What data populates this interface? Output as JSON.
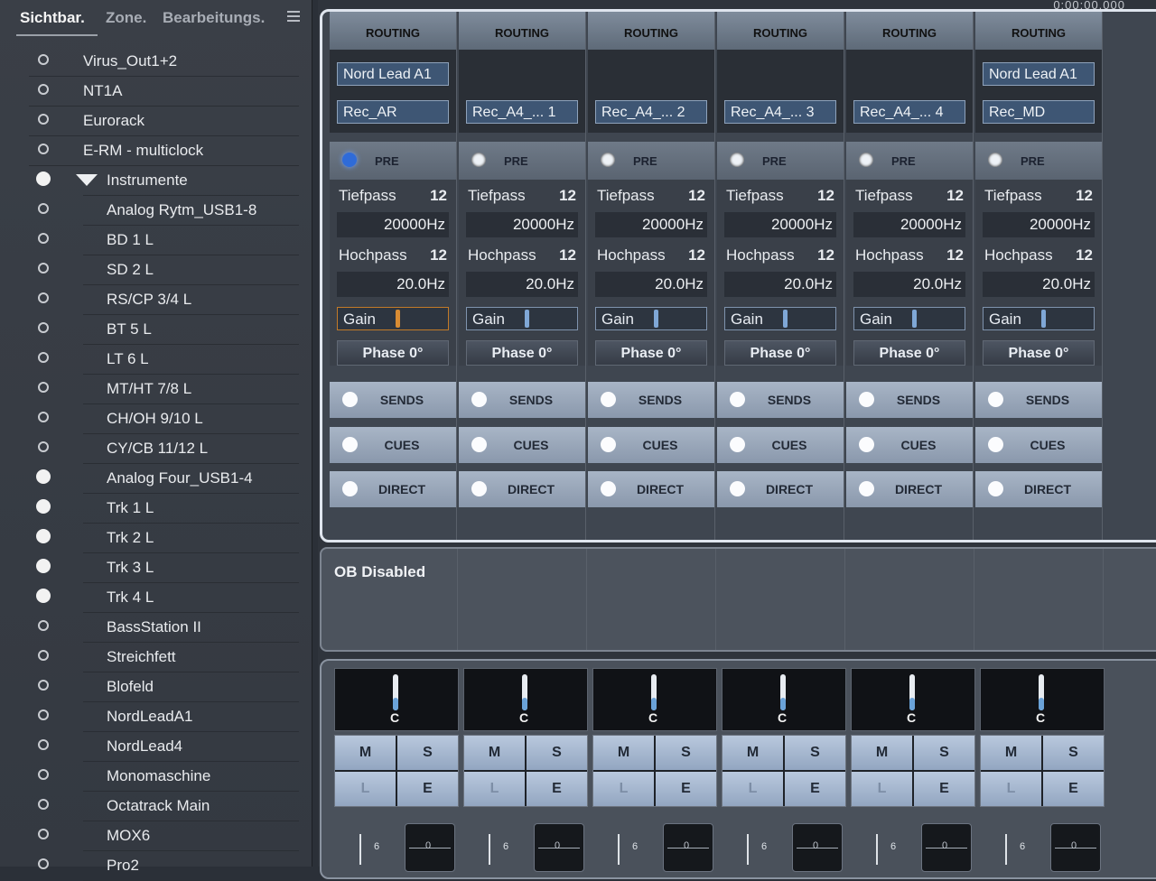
{
  "tabs": {
    "visible": "Sichtbar.",
    "zone": "Zone.",
    "edit": "Bearbeitungs."
  },
  "timecode": "0:00:00.000",
  "tracks": [
    {
      "name": "Virus_Out1+2",
      "on": false,
      "indent": 0
    },
    {
      "name": "NT1A",
      "on": false,
      "indent": 0
    },
    {
      "name": "Eurorack",
      "on": false,
      "indent": 0
    },
    {
      "name": "E-RM - multiclock",
      "on": false,
      "indent": 0
    },
    {
      "name": "Instrumente",
      "on": true,
      "indent": 1,
      "folder": true
    },
    {
      "name": "Analog Rytm_USB1-8",
      "on": false,
      "indent": 2
    },
    {
      "name": "BD 1 L",
      "on": false,
      "indent": 2
    },
    {
      "name": "SD 2 L",
      "on": false,
      "indent": 2
    },
    {
      "name": "RS/CP 3/4 L",
      "on": false,
      "indent": 2
    },
    {
      "name": "BT 5 L",
      "on": false,
      "indent": 2
    },
    {
      "name": "LT 6 L",
      "on": false,
      "indent": 2
    },
    {
      "name": "MT/HT 7/8 L",
      "on": false,
      "indent": 2
    },
    {
      "name": "CH/OH 9/10 L",
      "on": false,
      "indent": 2
    },
    {
      "name": "CY/CB 11/12 L",
      "on": false,
      "indent": 2
    },
    {
      "name": "Analog Four_USB1-4",
      "on": true,
      "indent": 2
    },
    {
      "name": "Trk 1 L",
      "on": true,
      "indent": 2
    },
    {
      "name": "Trk 2 L",
      "on": true,
      "indent": 2
    },
    {
      "name": "Trk 3 L",
      "on": true,
      "indent": 2
    },
    {
      "name": "Trk 4 L",
      "on": true,
      "indent": 2
    },
    {
      "name": "BassStation II",
      "on": false,
      "indent": 2
    },
    {
      "name": "Streichfett",
      "on": false,
      "indent": 2
    },
    {
      "name": "Blofeld",
      "on": false,
      "indent": 2
    },
    {
      "name": "NordLeadA1",
      "on": false,
      "indent": 2
    },
    {
      "name": "NordLead4",
      "on": false,
      "indent": 2
    },
    {
      "name": "Monomaschine",
      "on": false,
      "indent": 2
    },
    {
      "name": "Octatrack Main",
      "on": false,
      "indent": 2
    },
    {
      "name": "MOX6",
      "on": false,
      "indent": 2
    },
    {
      "name": "Pro2",
      "on": false,
      "indent": 2
    }
  ],
  "channels": [
    {
      "routing_label": "ROUTING",
      "input": "Nord Lead A1",
      "output": "Rec_AR",
      "pre_label": "PRE",
      "pre_active": true,
      "lowpass_label": "Tiefpass",
      "lowpass_value": "20000Hz",
      "highpass_label": "Hochpass",
      "highpass_value": "20.0Hz",
      "slope": "12",
      "gain_label": "Gain",
      "gain_highlight": true,
      "phase": "Phase 0°"
    },
    {
      "routing_label": "ROUTING",
      "input": "",
      "output": "Rec_A4_... 1",
      "pre_label": "PRE",
      "pre_active": false,
      "lowpass_label": "Tiefpass",
      "lowpass_value": "20000Hz",
      "highpass_label": "Hochpass",
      "highpass_value": "20.0Hz",
      "slope": "12",
      "gain_label": "Gain",
      "gain_highlight": false,
      "phase": "Phase 0°"
    },
    {
      "routing_label": "ROUTING",
      "input": "",
      "output": "Rec_A4_... 2",
      "pre_label": "PRE",
      "pre_active": false,
      "lowpass_label": "Tiefpass",
      "lowpass_value": "20000Hz",
      "highpass_label": "Hochpass",
      "highpass_value": "20.0Hz",
      "slope": "12",
      "gain_label": "Gain",
      "gain_highlight": false,
      "phase": "Phase 0°"
    },
    {
      "routing_label": "ROUTING",
      "input": "",
      "output": "Rec_A4_... 3",
      "pre_label": "PRE",
      "pre_active": false,
      "lowpass_label": "Tiefpass",
      "lowpass_value": "20000Hz",
      "highpass_label": "Hochpass",
      "highpass_value": "20.0Hz",
      "slope": "12",
      "gain_label": "Gain",
      "gain_highlight": false,
      "phase": "Phase 0°"
    },
    {
      "routing_label": "ROUTING",
      "input": "",
      "output": "Rec_A4_... 4",
      "pre_label": "PRE",
      "pre_active": false,
      "lowpass_label": "Tiefpass",
      "lowpass_value": "20000Hz",
      "highpass_label": "Hochpass",
      "highpass_value": "20.0Hz",
      "slope": "12",
      "gain_label": "Gain",
      "gain_highlight": false,
      "phase": "Phase 0°"
    },
    {
      "routing_label": "ROUTING",
      "input": "Nord Lead A1",
      "output": "Rec_MD",
      "pre_label": "PRE",
      "pre_active": false,
      "lowpass_label": "Tiefpass",
      "lowpass_value": "20000Hz",
      "highpass_label": "Hochpass",
      "highpass_value": "20.0Hz",
      "slope": "12",
      "gain_label": "Gain",
      "gain_highlight": false,
      "phase": "Phase 0°"
    }
  ],
  "sections": {
    "sends": "SENDS",
    "cues": "CUES",
    "direct": "DIRECT"
  },
  "ob_label": "OB Disabled",
  "strip": {
    "pan_label": "C",
    "mute": "M",
    "solo": "S",
    "listen": "L",
    "edit": "E",
    "fader_tick": "6",
    "fader_cap": "0"
  }
}
